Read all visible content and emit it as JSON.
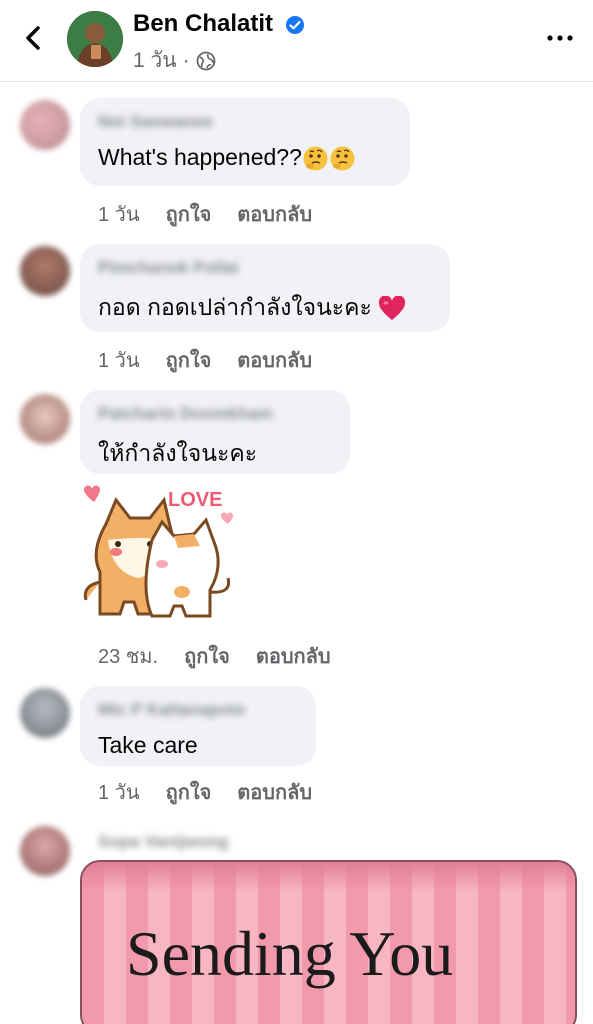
{
  "header": {
    "name": "Ben Chalatit",
    "time": "1 วัน",
    "separator": "·",
    "icons": {
      "back": "chevron-left-icon",
      "verified": "verified-badge-icon",
      "privacy": "globe-icon",
      "more": "more-horizontal-icon"
    }
  },
  "comments": [
    {
      "name": "Noi Saowanee",
      "text": "What's happened??",
      "emoji": "thinking-face-emoji",
      "time": "1 วัน",
      "like": "ถูกใจ",
      "reply": "ตอบกลับ"
    },
    {
      "name": "Pimchanok Pollai",
      "text": "กอด กอดเปล่ากำลังใจนะคะ",
      "emoji": "red-heart-emoji",
      "time": "1 วัน",
      "like": "ถูกใจ",
      "reply": "ตอบกลับ"
    },
    {
      "name": "Patcharin Doomkham",
      "text": "ให้กำลังใจนะคะ",
      "sticker": {
        "label": "LOVE",
        "icon": "cat-hug-sticker"
      },
      "time": "23 ชม.",
      "like": "ถูกใจ",
      "reply": "ตอบกลับ"
    },
    {
      "name": "Mic P Kattanapote",
      "text": "Take care",
      "time": "1 วัน",
      "like": "ถูกใจ",
      "reply": "ตอบกลับ"
    },
    {
      "name": "Sopa Vanijwong",
      "image_text": "Sending You"
    }
  ],
  "colors": {
    "bubble": "#f0f2f5",
    "secondary_text": "#65676b",
    "verified": "#1877f2",
    "heart": "#e0245e"
  }
}
